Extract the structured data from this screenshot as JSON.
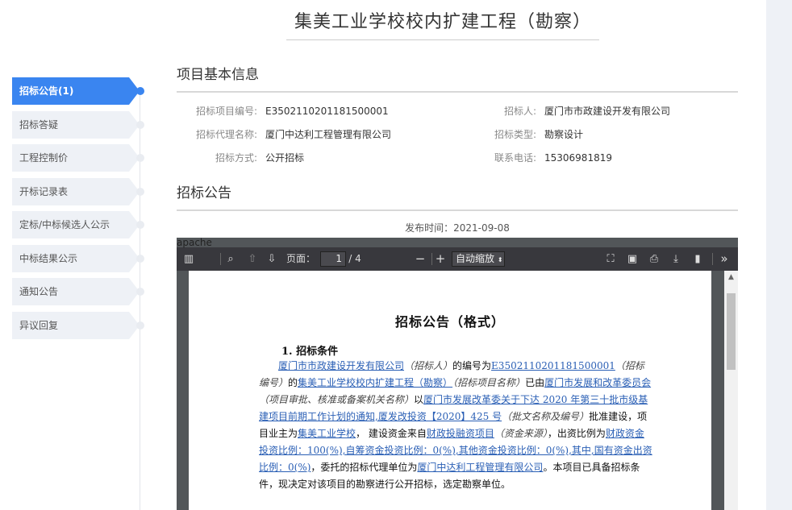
{
  "page_title": "集美工业学校校内扩建工程（勘察）",
  "nav": {
    "items": [
      {
        "label": "招标公告(1)",
        "active": true
      },
      {
        "label": "招标答疑",
        "active": false
      },
      {
        "label": "工程控制价",
        "active": false
      },
      {
        "label": "开标记录表",
        "active": false
      },
      {
        "label": "定标/中标候选人公示",
        "active": false
      },
      {
        "label": "中标结果公示",
        "active": false
      },
      {
        "label": "通知公告",
        "active": false
      },
      {
        "label": "异议回复",
        "active": false
      }
    ]
  },
  "basic_info": {
    "heading": "项目基本信息",
    "fields": [
      {
        "label": "招标项目编号:",
        "value": "E3502110201181500001"
      },
      {
        "label": "招标人:",
        "value": "厦门市市政建设开发有限公司"
      },
      {
        "label": "招标代理名称:",
        "value": "厦门中达利工程管理有限公司"
      },
      {
        "label": "招标类型:",
        "value": "勘察设计"
      },
      {
        "label": "招标方式:",
        "value": "公开招标"
      },
      {
        "label": "联系电话:",
        "value": "15306981819"
      }
    ]
  },
  "notice": {
    "heading": "招标公告",
    "publish_label": "发布时间：",
    "publish_date": "2021-09-08"
  },
  "apache_label": "apache",
  "pdf_viewer": {
    "page_label": "页面：",
    "current_page": "1",
    "total_pages": "/ 4",
    "zoom": "自动缩放",
    "zoom_out": "−",
    "zoom_in": "+"
  },
  "document": {
    "title": "招标公告（格式）",
    "section1_heading": "1. 招标条件",
    "p1": {
      "t1": "厦门市市政建设开发有限公司",
      "t2": "（招标人）",
      "t3": "的编号为",
      "t4": "E3502110201181500001",
      "t5": "（招标编号）",
      "t6": "的",
      "t7": "集美工业学校校内扩建工程（勘察）",
      "t8": "（招标项目名称）",
      "t9": "已由",
      "t10": "厦门市发展和改革委员会",
      "t11": "（项目审批、核准或备案机关名称）",
      "t12": "以",
      "t13": "厦门市发展改革委关于下达 2020 年第三十批市级基建项目前期工作计划的通知,厦发改投资【2020】425 号",
      "t14": "（批文名称及编号）",
      "t15": "批准建设，项目业主为",
      "t16": "集美工业学校",
      "t17": "，  建设资金来自",
      "t18": "财政投融资项目",
      "t19": "（资金来源）",
      "t20": "，出资比例为",
      "t21": "财政资金投资比例：100(%),自筹资金投资比例：0(%),其他资金投资比例：0(%),其中,国有资金出资比例：0(%)",
      "t22": "，委托的招标代理单位为",
      "t23": "厦门中达利工程管理有限公司",
      "t24": "。本项目已具备招标条件，现决定对该项目的勘察进行公开招标，选定勘察单位。"
    }
  },
  "colors": {
    "accent": "#3a85f0",
    "nav_bg": "#eef1f6",
    "toolbar": "#38383d",
    "viewer_bg": "#525659",
    "link": "#2a5fb5"
  }
}
